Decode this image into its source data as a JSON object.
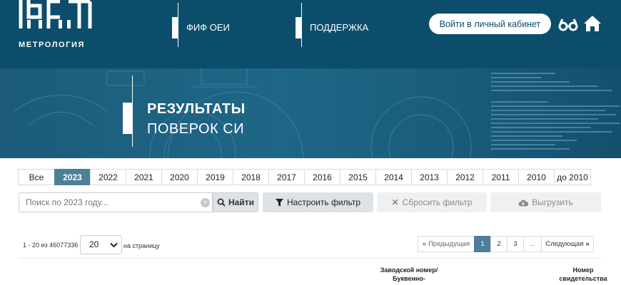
{
  "header": {
    "logo_text": "МЕТРОЛОГИЯ",
    "nav": [
      {
        "label": "ФИФ ОЕИ"
      },
      {
        "label": "ПОДДЕРЖКА"
      }
    ],
    "login_label": "Войти в личный кабинет",
    "icons": [
      "glasses-icon",
      "home-icon"
    ]
  },
  "banner": {
    "title": "РЕЗУЛЬТАТЫ",
    "subtitle": "ПОВЕРОК СИ"
  },
  "years": {
    "tabs": [
      "Все",
      "2023",
      "2022",
      "2021",
      "2020",
      "2019",
      "2018",
      "2017",
      "2016",
      "2015",
      "2014",
      "2013",
      "2012",
      "2011",
      "2010",
      "до 2010"
    ],
    "active": "2023"
  },
  "search": {
    "placeholder": "Поиск по 2023 году...",
    "find_label": "Найти",
    "filter_label": "Настроить фильтр",
    "reset_label": "Сбросить фильтр",
    "export_label": "Выгрузить"
  },
  "results": {
    "count_text": "1 - 20 из 46077336",
    "per_page_value": "20",
    "per_page_label": "на страницу"
  },
  "pagination": {
    "prev_label": "Предыдущая",
    "pages": [
      "1",
      "2",
      "3",
      "..."
    ],
    "active_page": "1",
    "next_label": "Следующая"
  },
  "table": {
    "headers": {
      "serial": "Заводской номер/ Буквенно-",
      "certificate": "Номер свидетельства"
    }
  },
  "colors": {
    "header_bg": "#0c4d6b",
    "accent": "#4e7f99"
  }
}
